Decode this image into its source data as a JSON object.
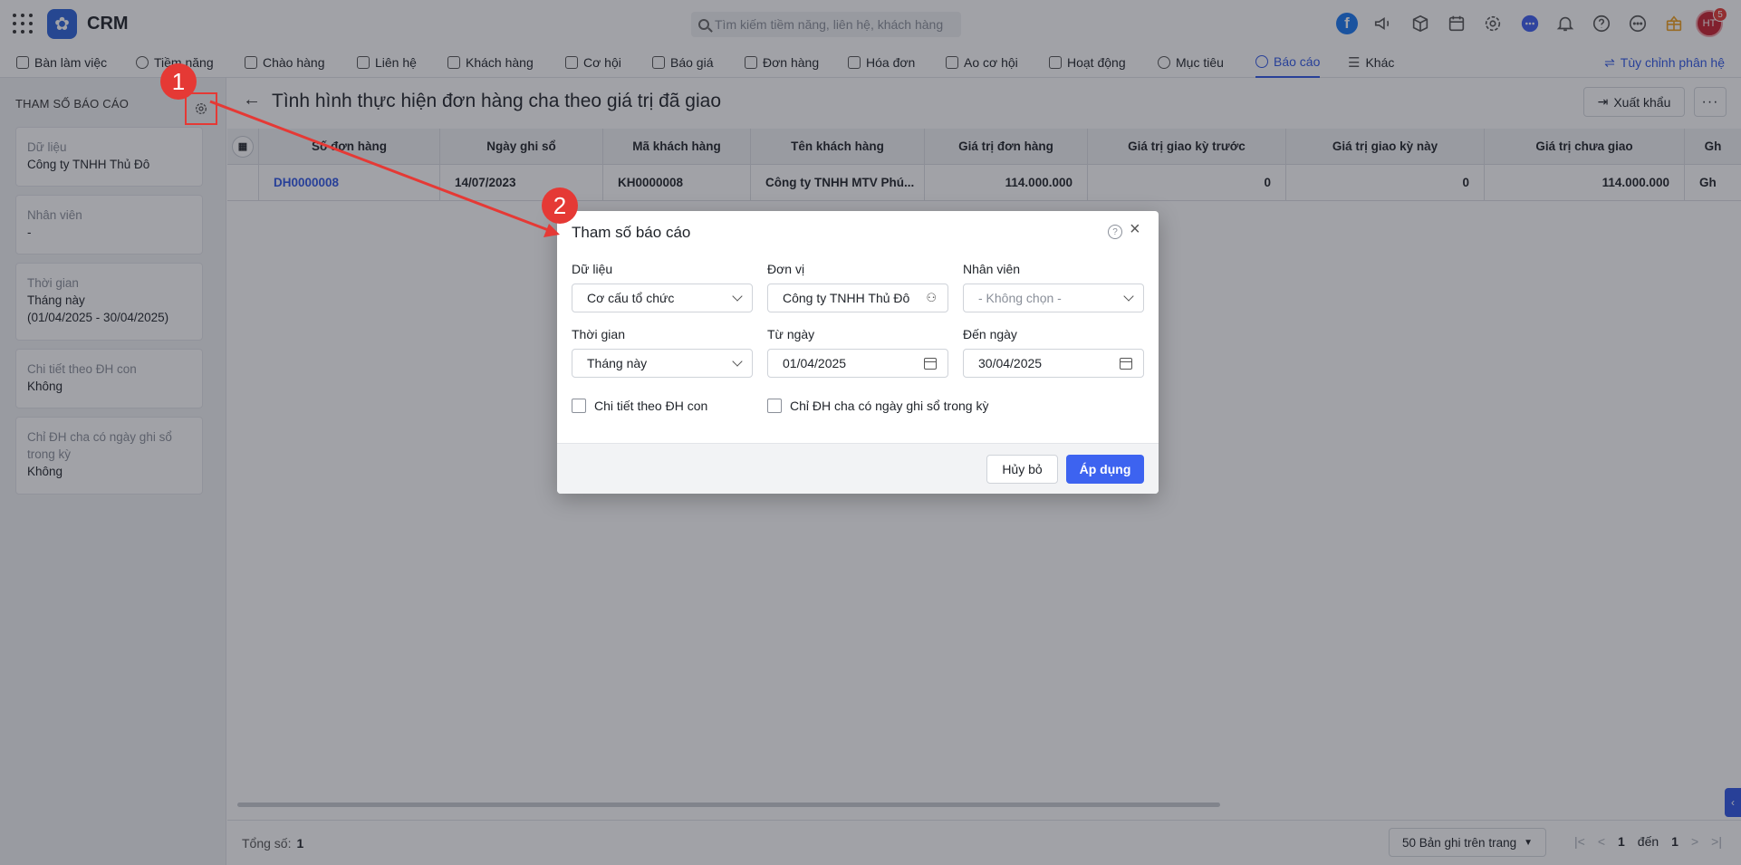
{
  "app": {
    "name": "CRM"
  },
  "search": {
    "placeholder": "Tìm kiếm tiềm năng, liên hệ, khách hàng"
  },
  "header_icons": [
    "facebook-icon",
    "megaphone-icon",
    "box-icon",
    "calendar-icon",
    "gear-icon",
    "chat-icon",
    "bell-icon",
    "help-icon",
    "more-icon",
    "gift-icon"
  ],
  "user": {
    "initials": "HT",
    "notifications": "5"
  },
  "nav": {
    "items": [
      "Bàn làm việc",
      "Tiềm năng",
      "Chào hàng",
      "Liên hệ",
      "Khách hàng",
      "Cơ hội",
      "Báo giá",
      "Đơn hàng",
      "Hóa đơn",
      "Ao cơ hội",
      "Hoạt động",
      "Mục tiêu",
      "Báo cáo",
      "Khác"
    ],
    "active": "Báo cáo",
    "customize": "Tùy chỉnh phân hệ"
  },
  "sidebar": {
    "title": "THAM SỐ BÁO CÁO",
    "cards": [
      {
        "label": "Dữ liệu",
        "value": "Công ty TNHH Thủ Đô"
      },
      {
        "label": "Nhân viên",
        "value": "-"
      },
      {
        "label": "Thời gian",
        "value": "Tháng này",
        "value2": "(01/04/2025 - 30/04/2025)"
      },
      {
        "label": "Chi tiết theo ĐH con",
        "value": "Không"
      },
      {
        "label": "Chỉ ĐH cha có ngày ghi sổ trong kỳ",
        "value": "Không"
      }
    ]
  },
  "page": {
    "title": "Tình hình thực hiện đơn hàng cha theo giá trị đã giao",
    "export_label": "Xuất khẩu",
    "more_label": "···"
  },
  "table": {
    "headers": [
      "Số đơn hàng",
      "Ngày ghi sổ",
      "Mã khách hàng",
      "Tên khách hàng",
      "Giá trị đơn hàng",
      "Giá trị giao kỳ trước",
      "Giá trị giao kỳ này",
      "Giá trị chưa giao",
      "Gh"
    ],
    "rows": [
      [
        "DH0000008",
        "14/07/2023",
        "KH0000008",
        "Công ty TNHH MTV Phú...",
        "114.000.000",
        "0",
        "0",
        "114.000.000",
        "Gh"
      ]
    ]
  },
  "footer": {
    "total_label": "Tổng số:",
    "total_value": "1",
    "page_size": "50 Bản ghi trên trang",
    "pager_from": "1",
    "pager_to_label": "đến",
    "pager_to": "1"
  },
  "dialog": {
    "title": "Tham số báo cáo",
    "help": "?",
    "close": "×",
    "fields": {
      "data_label": "Dữ liệu",
      "data_value": "Cơ cấu tổ chức",
      "unit_label": "Đơn vị",
      "unit_value": "Công ty TNHH Thủ Đô",
      "employee_label": "Nhân viên",
      "employee_placeholder": "- Không chọn -",
      "time_label": "Thời gian",
      "time_value": "Tháng này",
      "from_label": "Từ ngày",
      "from_value": "01/04/2025",
      "to_label": "Đến ngày",
      "to_value": "30/04/2025"
    },
    "checkboxes": {
      "detail_child": "Chi tiết theo ĐH con",
      "only_parent": "Chỉ ĐH cha có ngày ghi sổ trong kỳ"
    },
    "cancel_label": "Hủy bỏ",
    "apply_label": "Áp dụng"
  },
  "annotations": {
    "step1": "1",
    "step2": "2"
  },
  "colors": {
    "accent": "#2f57e6",
    "apply_button": "#3d63f0",
    "annotation_red": "#e53935"
  }
}
